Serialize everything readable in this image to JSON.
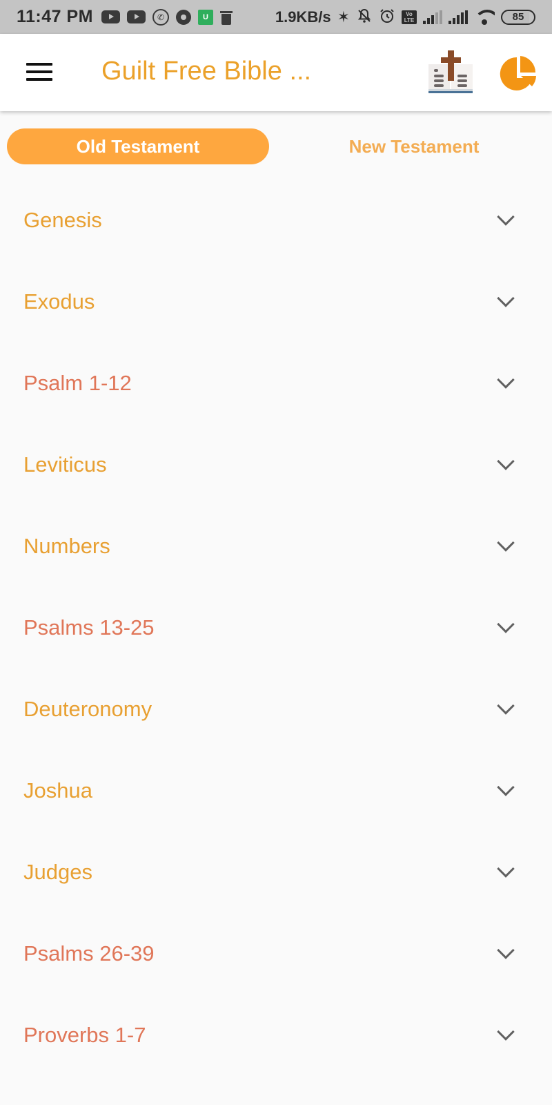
{
  "status_bar": {
    "time": "11:47 PM",
    "network_speed": "1.9KB/s",
    "battery_level": "85",
    "left_icons": [
      "youtube-icon",
      "youtube-icon",
      "whatsapp-icon",
      "disc-icon",
      "mi-app-icon",
      "trash-icon"
    ],
    "right_icons": [
      "bluetooth-icon",
      "bell-off-icon",
      "alarm-icon",
      "volte-icon",
      "signal-icon",
      "signal-icon",
      "wifi-icon",
      "battery-icon"
    ],
    "glyphs": {
      "bluetooth": "✶",
      "bell_off": "🔕",
      "alarm": "⏰",
      "volte_top": "Vo",
      "volte_bottom": "LTE",
      "whatsapp": "✆",
      "mi": "U"
    }
  },
  "app_bar": {
    "title": "Guilt Free Bible ...",
    "menu_icon": "hamburger-menu-icon",
    "actions": [
      "bible-book-icon",
      "pie-chart-icon"
    ]
  },
  "tabs": [
    {
      "label": "Old Testament",
      "active": true
    },
    {
      "label": "New Testament",
      "active": false
    }
  ],
  "books": [
    {
      "name": "Genesis",
      "type": "book"
    },
    {
      "name": "Exodus",
      "type": "book"
    },
    {
      "name": "Psalm 1-12",
      "type": "psalm"
    },
    {
      "name": "Leviticus",
      "type": "book"
    },
    {
      "name": "Numbers",
      "type": "book"
    },
    {
      "name": "Psalms 13-25",
      "type": "psalm"
    },
    {
      "name": "Deuteronomy",
      "type": "book"
    },
    {
      "name": "Joshua",
      "type": "book"
    },
    {
      "name": "Judges",
      "type": "book"
    },
    {
      "name": "Psalms 26-39",
      "type": "psalm"
    },
    {
      "name": "Proverbs 1-7",
      "type": "psalm"
    }
  ],
  "colors": {
    "accent": "#fea73f",
    "title": "#eba12a",
    "book_text": "#e8a032",
    "psalm_text": "#e07658",
    "chevron": "#606060",
    "background": "#fafafa"
  }
}
